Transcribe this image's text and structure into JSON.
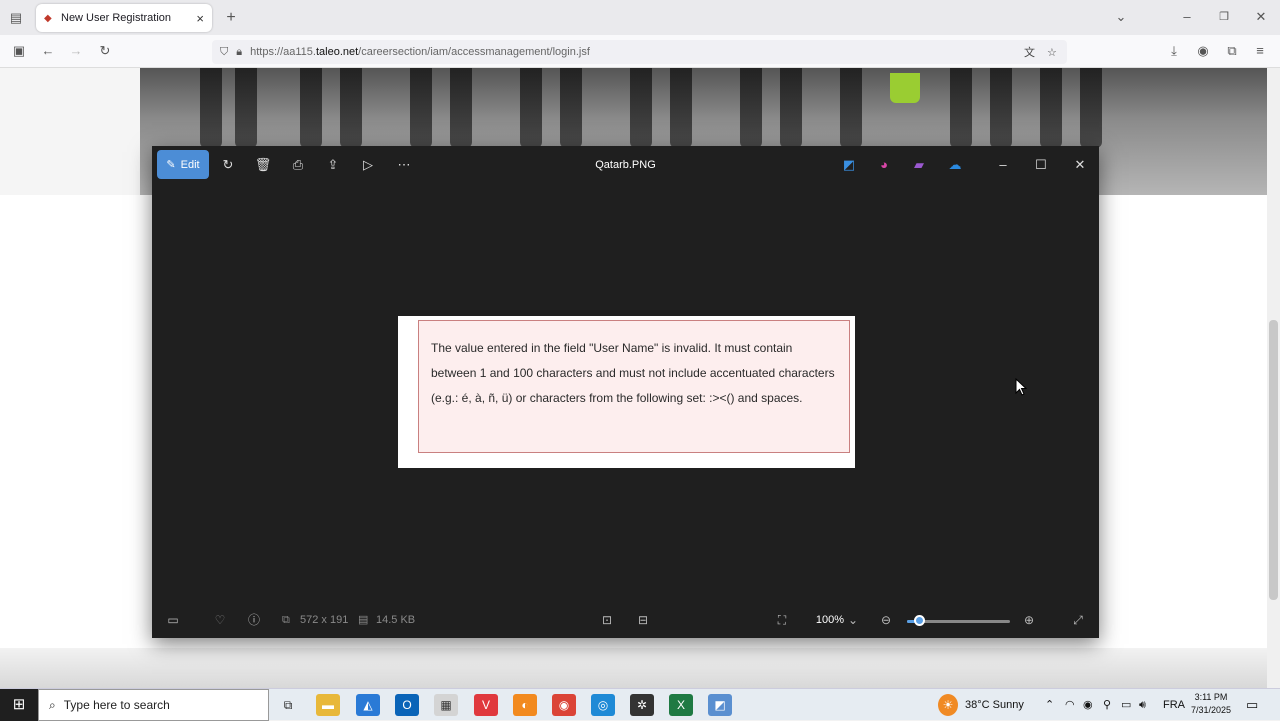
{
  "browser": {
    "tab_title": "New User Registration",
    "new_tab_symbol": "+",
    "url_prefix": "https://aa115.",
    "url_domain": "taleo.net",
    "url_path": "/careersection/iam/accessmanagement/login.jsf"
  },
  "viewer": {
    "title": "Qatarb.PNG",
    "edit_label": "Edit",
    "error_message": "The value entered in the field \"User Name\" is invalid. It must contain between 1 and 100 characters and must not include accentuated characters (e.g.: é, à, ñ, ü) or characters from the following set: :><() and spaces.",
    "dimensions": "572 x 191",
    "file_size": "14.5 KB",
    "zoom": "100%",
    "zoom_fraction": 0.12
  },
  "taskbar": {
    "search_placeholder": "Type here to search",
    "weather": "38°C  Sunny",
    "language": "FRA",
    "time": "3:11 PM",
    "date": "7/31/2025"
  }
}
